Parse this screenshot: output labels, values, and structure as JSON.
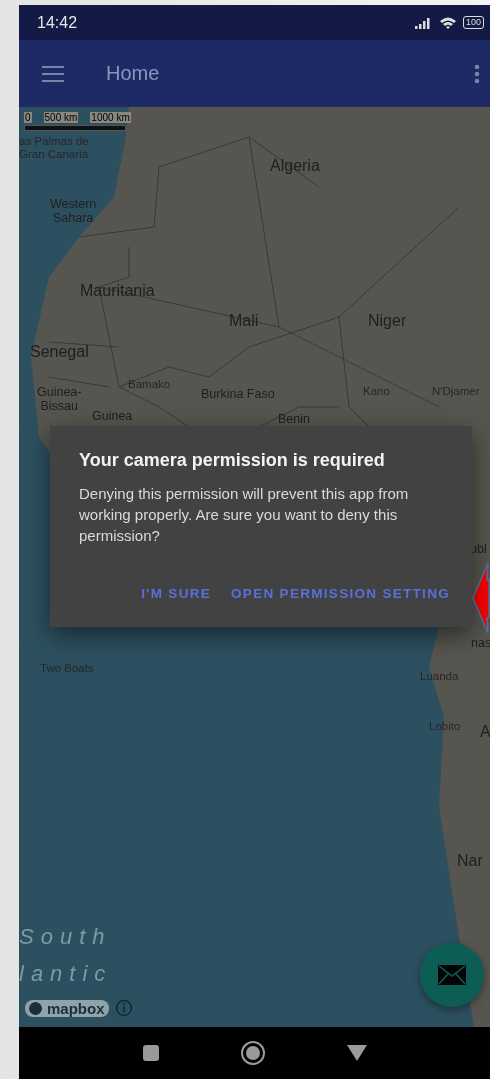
{
  "status_bar": {
    "time": "14:42",
    "battery": "100"
  },
  "app_bar": {
    "title": "Home"
  },
  "map": {
    "scale": [
      "0",
      "500 km",
      "1000 km"
    ],
    "labels": [
      {
        "text": "as Palmas de\nGran Canaria",
        "kind": "city"
      },
      {
        "text": "Algeria",
        "kind": "country"
      },
      {
        "text": "Western\nSahara",
        "kind": "region"
      },
      {
        "text": "Mauritania",
        "kind": "country"
      },
      {
        "text": "Mali",
        "kind": "country"
      },
      {
        "text": "Niger",
        "kind": "country"
      },
      {
        "text": "Senegal",
        "kind": "country"
      },
      {
        "text": "Guinea-\nBissau",
        "kind": "region"
      },
      {
        "text": "Bamako",
        "kind": "capital"
      },
      {
        "text": "Burkina Faso",
        "kind": "region"
      },
      {
        "text": "Guinea",
        "kind": "region"
      },
      {
        "text": "Kano",
        "kind": "city"
      },
      {
        "text": "N'Djamer",
        "kind": "capital"
      },
      {
        "text": "Benin",
        "kind": "region"
      },
      {
        "text": "ubl",
        "kind": "region"
      },
      {
        "text": "nas",
        "kind": "region"
      },
      {
        "text": "Two Boats",
        "kind": "city"
      },
      {
        "text": "Luanda",
        "kind": "capital"
      },
      {
        "text": "Lobito",
        "kind": "city"
      },
      {
        "text": "A",
        "kind": "country"
      },
      {
        "text": "Nar",
        "kind": "country"
      },
      {
        "text": "South",
        "kind": "ocean"
      },
      {
        "text": "lantic",
        "kind": "ocean"
      }
    ],
    "attribution": "mapbox"
  },
  "dialog": {
    "title": "Your camera permission is required",
    "message": "Denying this permission will prevent this app from working properly. Are sure you want to deny this permission?",
    "buttons": [
      "I'M SURE",
      "OPEN PERMISSION SETTING"
    ]
  }
}
